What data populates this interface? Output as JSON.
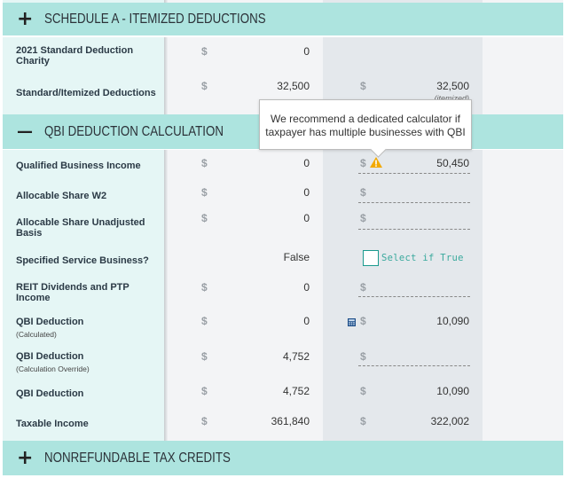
{
  "sections": {
    "schedule_a": {
      "sign": "+",
      "title": "SCHEDULE A - ITEMIZED DEDUCTIONS",
      "expanded": false
    },
    "qbi": {
      "sign": "—",
      "title": "QBI DEDUCTION CALCULATION",
      "expanded": true
    },
    "nonrefundable": {
      "sign": "+",
      "title": "NONREFUNDABLE TAX CREDITS",
      "expanded": false
    }
  },
  "currency_symbol": "$",
  "top_rows": [
    {
      "label": "2021 Standard Deduction Charity",
      "col1": "0",
      "col2": ""
    },
    {
      "label": "Standard/Itemized Deductions",
      "col1": "32,500",
      "col2": "32,500",
      "col2_note": "(itemized)"
    }
  ],
  "tooltip": {
    "text_line1": "We recommend a dedicated calculator if",
    "text_line2": "taxpayer has multiple businesses with QBI"
  },
  "qbi_rows": [
    {
      "label": "Qualified Business Income",
      "sublabel": "",
      "col1": "0",
      "col2": "50,450",
      "col2_editable": true,
      "icon": "warning-icon"
    },
    {
      "label": "Allocable Share W2",
      "sublabel": "",
      "col1": "0",
      "col2": "",
      "col2_editable": true
    },
    {
      "label": "Allocable Share Unadjusted Basis",
      "sublabel": "",
      "col1": "0",
      "col2": "",
      "col2_editable": true
    },
    {
      "label": "Specified Service Business?",
      "sublabel": "",
      "col1": "False",
      "col2_checkbox_label": "Select if True",
      "col2_checked": false
    },
    {
      "label": "REIT Dividends and PTP Income",
      "sublabel": "",
      "col1": "0",
      "col2": "",
      "col2_editable": true
    },
    {
      "label": "QBI Deduction",
      "sublabel": "(Calculated)",
      "col1": "0",
      "col2": "10,090",
      "icon": "calculator-icon"
    },
    {
      "label": "QBI Deduction",
      "sublabel": "(Calculation Override)",
      "col1": "4,752",
      "col2": "",
      "col2_editable": true
    },
    {
      "label": "QBI Deduction",
      "sublabel": "",
      "col1": "4,752",
      "col2": "10,090"
    },
    {
      "label": "Taxable Income",
      "sublabel": "",
      "col1": "361,840",
      "col2": "322,002"
    }
  ],
  "colors": {
    "section_header_bg": "#ade4df",
    "label_col_bg": "#e5f6f5",
    "col1_bg": "#f3f4f6",
    "col2_bg": "#e4e8ec",
    "warning": "#f2a900",
    "checkbox_border": "#1a9a8e",
    "checkbox_label": "#3aa99d",
    "calculator_icon": "#1d4e89"
  }
}
